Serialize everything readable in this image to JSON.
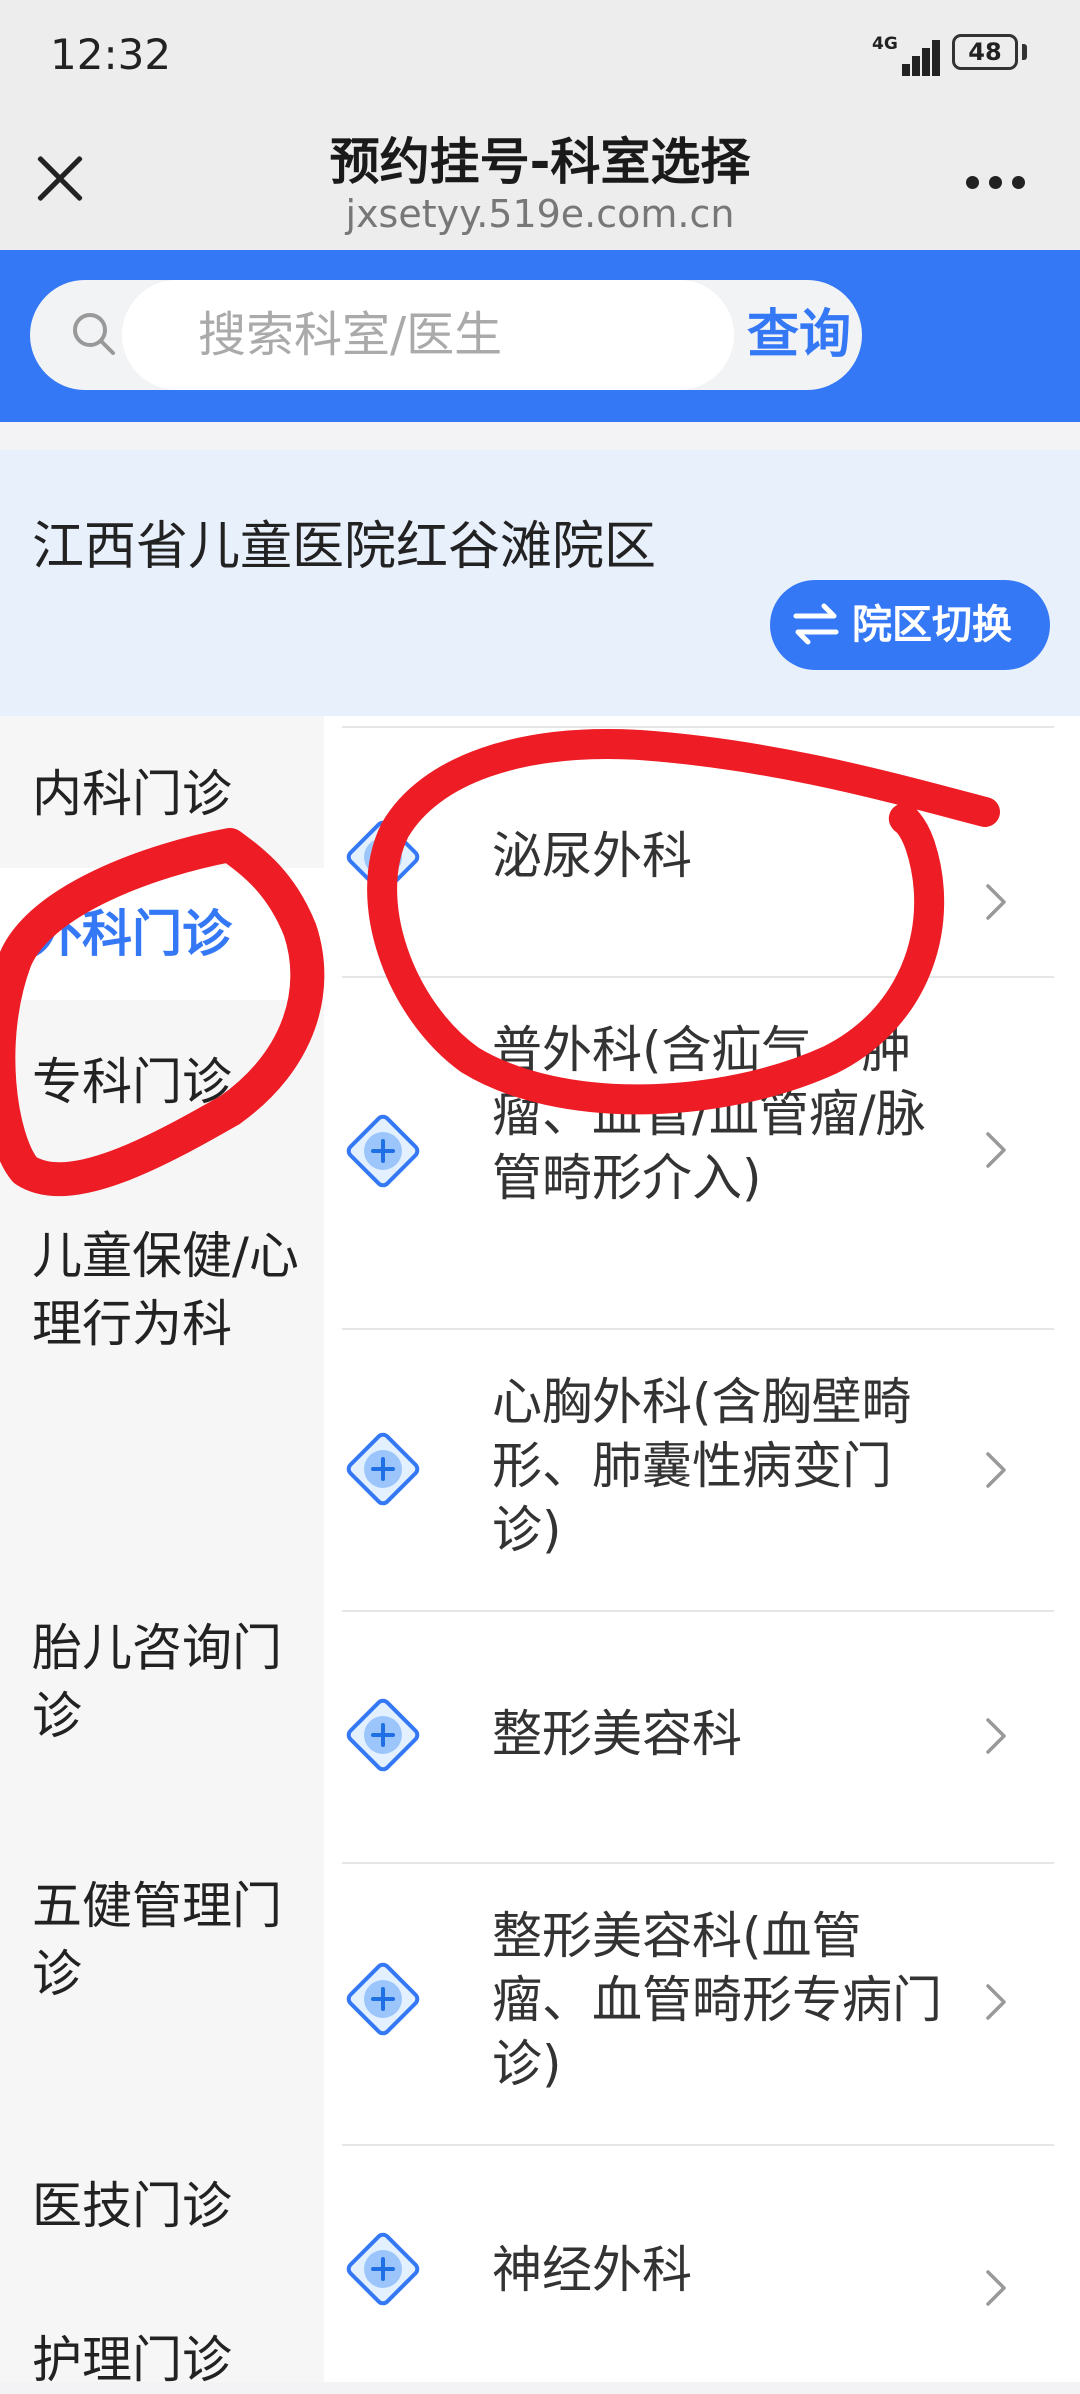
{
  "status_bar": {
    "time": "12:32",
    "network": "4G",
    "battery": "48"
  },
  "title_bar": {
    "title": "预约挂号-科室选择",
    "url": "jxsetyy.519e.com.cn"
  },
  "search": {
    "placeholder": "搜索科室/医生",
    "button_label": "查询"
  },
  "hospital": {
    "name": "江西省儿童医院红谷滩院区",
    "switch_label": "院区切换"
  },
  "sidebar": {
    "active_index": 1,
    "items": [
      {
        "label": "内科门诊"
      },
      {
        "label": "外科门诊"
      },
      {
        "label": "专科门诊"
      },
      {
        "label": "儿童保健/心理行为科"
      },
      {
        "label": "胎儿咨询门诊"
      },
      {
        "label": "五健管理门诊"
      },
      {
        "label": "医技门诊"
      },
      {
        "label": "护理门诊"
      }
    ]
  },
  "departments": [
    {
      "name": "泌尿外科"
    },
    {
      "name": "普外科(含疝气、肿瘤、血管/血管瘤/脉管畸形介入)"
    },
    {
      "name": "心胸外科(含胸壁畸形、肺囊性病变门诊)"
    },
    {
      "name": "整形美容科"
    },
    {
      "name": "整形美容科(血管瘤、血管畸形专病门诊)"
    },
    {
      "name": "神经外科"
    }
  ],
  "colors": {
    "accent": "#3478f6",
    "annotation": "#ee1c24",
    "sidebar_bg": "#f6f6f7",
    "hospital_bg": "#e8f0fc"
  }
}
